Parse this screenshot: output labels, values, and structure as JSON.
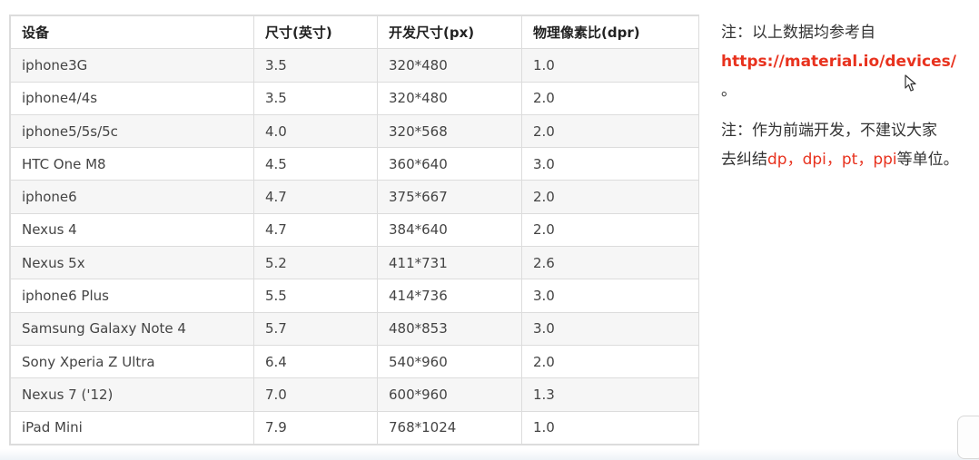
{
  "table": {
    "headers": [
      "设备",
      "尺寸(英寸)",
      "开发尺寸(px)",
      "物理像素比(dpr)"
    ],
    "rows": [
      [
        "iphone3G",
        "3.5",
        "320*480",
        "1.0"
      ],
      [
        "iphone4/4s",
        "3.5",
        "320*480",
        "2.0"
      ],
      [
        "iphone5/5s/5c",
        "4.0",
        "320*568",
        "2.0"
      ],
      [
        "HTC One M8",
        "4.5",
        "360*640",
        "3.0"
      ],
      [
        "iphone6",
        "4.7",
        "375*667",
        "2.0"
      ],
      [
        "Nexus 4",
        "4.7",
        "384*640",
        "2.0"
      ],
      [
        "Nexus 5x",
        "5.2",
        "411*731",
        "2.6"
      ],
      [
        "iphone6 Plus",
        "5.5",
        "414*736",
        "3.0"
      ],
      [
        "Samsung Galaxy Note 4",
        "5.7",
        "480*853",
        "3.0"
      ],
      [
        "Sony Xperia Z Ultra",
        "6.4",
        "540*960",
        "2.0"
      ],
      [
        "Nexus 7 ('12)",
        "7.0",
        "600*960",
        "1.3"
      ],
      [
        "iPad Mini",
        "7.9",
        "768*1024",
        "1.0"
      ]
    ]
  },
  "notes": {
    "note1_prefix": "注：以上数据均参考自",
    "note1_link": "https://material.io/devices/",
    "note1_suffix": "。",
    "note2_line1": "注：作为前端开发，不建议大家",
    "note2_pre": "去纠结",
    "note2_units": "dp，dpi，pt，ppi",
    "note2_post": "等单位。"
  },
  "colors": {
    "accent_red": "#e8321e",
    "border": "#dcdcdc",
    "stripe": "#f6f6f6"
  },
  "icons": {
    "cursor": "mouse-pointer-icon"
  }
}
